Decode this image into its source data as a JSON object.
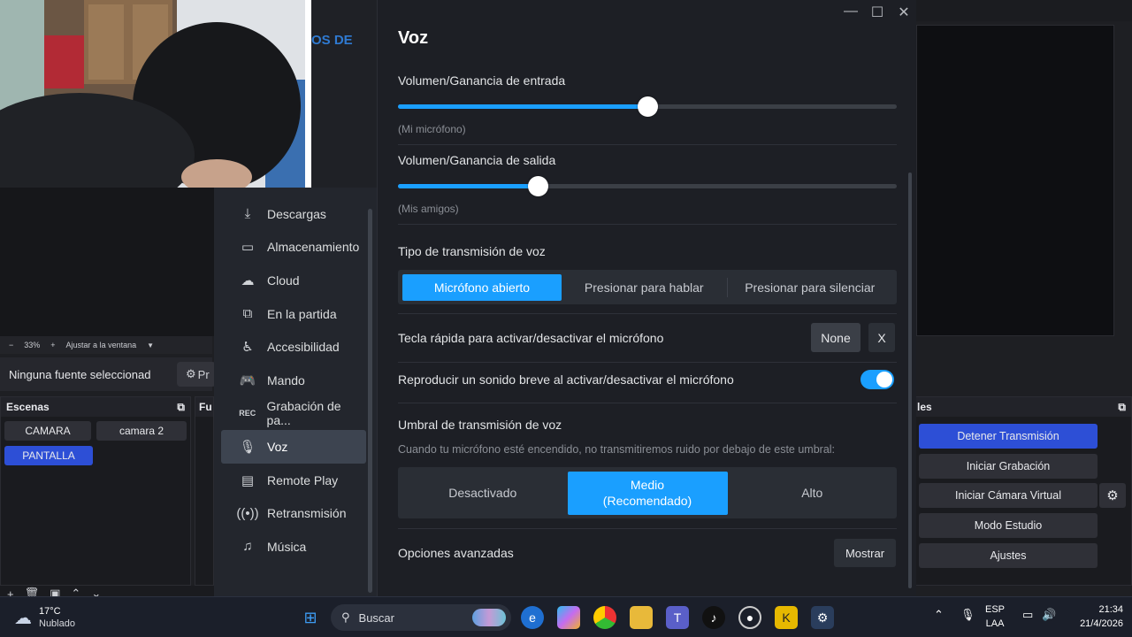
{
  "obs": {
    "zoom_label": "33%",
    "fit_label": "Ajustar a la ventana",
    "no_source": "Ninguna fuente seleccionad",
    "props_label": "Pr",
    "scenes_title": "Escenas",
    "sources_title": "Fu",
    "scenes": [
      "CAMARA",
      "camara 2",
      "PANTALLA"
    ],
    "controls_title": "les",
    "controls": [
      "Detener Transmisión",
      "Iniciar Grabación",
      "Iniciar Cámara Virtual",
      "Modo Estudio",
      "Ajustes"
    ]
  },
  "webcam_text": "OS DE",
  "sidebar": {
    "items": [
      {
        "label": "Descargas",
        "icon": "download-icon"
      },
      {
        "label": "Almacenamiento",
        "icon": "drive-icon"
      },
      {
        "label": "Cloud",
        "icon": "cloud-icon"
      },
      {
        "label": "En la partida",
        "icon": "overlay-icon"
      },
      {
        "label": "Accesibilidad",
        "icon": "accessibility-icon"
      },
      {
        "label": "Mando",
        "icon": "gamepad-icon"
      },
      {
        "label": "Grabación de pa...",
        "icon": "rec-icon"
      },
      {
        "label": "Voz",
        "icon": "microphone-icon"
      },
      {
        "label": "Remote Play",
        "icon": "monitor-icon"
      },
      {
        "label": "Retransmisión",
        "icon": "broadcast-icon"
      },
      {
        "label": "Música",
        "icon": "music-icon"
      }
    ],
    "active": "Voz"
  },
  "voice": {
    "title": "Voz",
    "input_label": "Volumen/Ganancia de entrada",
    "input_sub": "(Mi micrófono)",
    "input_value": 0.5,
    "output_label": "Volumen/Ganancia de salida",
    "output_sub": "(Mis amigos)",
    "output_value": 0.28,
    "tx_type_label": "Tipo de transmisión de voz",
    "tx_options": [
      "Micrófono abierto",
      "Presionar para hablar",
      "Presionar para silenciar"
    ],
    "tx_selected": "Micrófono abierto",
    "hotkey_label": "Tecla rápida para activar/desactivar el micrófono",
    "hotkey_value": "None",
    "hotkey_clear": "X",
    "sound_label": "Reproducir un sonido breve al activar/desactivar el micrófono",
    "sound_enabled": true,
    "threshold_label": "Umbral de transmisión de voz",
    "threshold_desc": "Cuando tu micrófono esté encendido, no transmitiremos ruido por debajo de este umbral:",
    "threshold_options": [
      "Desactivado",
      "Medio\n(Recomendado)",
      "Alto"
    ],
    "threshold_selected": "Medio (Recomendado)",
    "advanced_label": "Opciones avanzadas",
    "advanced_button": "Mostrar"
  },
  "taskbar": {
    "temp": "17°C",
    "weather": "Nublado",
    "search_placeholder": "Buscar",
    "lang_top": "ESP",
    "lang_bottom": "LAA",
    "time": "21:34",
    "date": "21/4/2026"
  },
  "colors": {
    "accent": "#1a9fff",
    "obs_active": "#2d4fd6"
  }
}
